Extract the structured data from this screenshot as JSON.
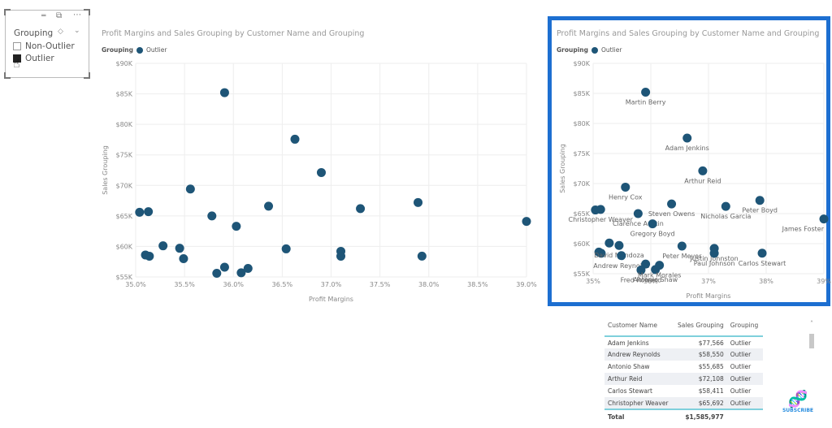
{
  "slicer": {
    "title": "Grouping",
    "items": [
      {
        "label": "Non-Outlier",
        "checked": false
      },
      {
        "label": "Outlier",
        "checked": true
      }
    ]
  },
  "chart_title": "Profit Margins and Sales Grouping by Customer Name and Grouping",
  "legend": {
    "title": "Grouping",
    "series": "Outlier"
  },
  "colors": {
    "point": "#1e5577",
    "highlight_border": "#1d6fd1"
  },
  "chart_data": [
    {
      "type": "scatter",
      "title": "Profit Margins and Sales Grouping by Customer Name and Grouping",
      "xlabel": "Profit Margins",
      "ylabel": "Sales Grouping",
      "xlim": [
        35.0,
        39.0
      ],
      "ylim": [
        55000,
        90000
      ],
      "xticks": [
        "35.0%",
        "35.5%",
        "36.0%",
        "36.5%",
        "37.0%",
        "37.5%",
        "38.0%",
        "38.5%",
        "39.0%"
      ],
      "yticks": [
        "$55K",
        "$60K",
        "$65K",
        "$70K",
        "$75K",
        "$80K",
        "$85K",
        "$90K"
      ],
      "grid": true,
      "legend_position": "top-left",
      "series": [
        {
          "name": "Outlier"
        }
      ]
    },
    {
      "type": "scatter",
      "title": "Profit Margins and Sales Grouping by Customer Name and Grouping",
      "xlabel": "Profit Margins",
      "ylabel": "Sales Grouping",
      "xlim": [
        35.0,
        39.0
      ],
      "ylim": [
        55000,
        90000
      ],
      "xticks": [
        "35%",
        "36%",
        "37%",
        "38%",
        "39%"
      ],
      "yticks": [
        "$55K",
        "$60K",
        "$65K",
        "$70K",
        "$75K",
        "$80K",
        "$85K",
        "$90K"
      ],
      "grid": true,
      "legend_position": "top-left",
      "data_labels": true,
      "series": [
        {
          "name": "Outlier"
        }
      ]
    }
  ],
  "points": [
    {
      "x": 35.04,
      "y": 65600,
      "name": ""
    },
    {
      "x": 35.13,
      "y": 65692,
      "name": "Christopher Weaver"
    },
    {
      "x": 35.1,
      "y": 58600,
      "name": ""
    },
    {
      "x": 35.14,
      "y": 58400,
      "name": ""
    },
    {
      "x": 35.28,
      "y": 60100,
      "name": ""
    },
    {
      "x": 35.45,
      "y": 59700,
      "name": "David Mendoza"
    },
    {
      "x": 35.49,
      "y": 58000,
      "name": "Andrew Reynolds"
    },
    {
      "x": 35.56,
      "y": 69400,
      "name": "Henry Cox"
    },
    {
      "x": 35.78,
      "y": 65000,
      "name": "Clarence Austin"
    },
    {
      "x": 35.91,
      "y": 85200,
      "name": "Martin Berry"
    },
    {
      "x": 35.91,
      "y": 56600,
      "name": ""
    },
    {
      "x": 35.83,
      "y": 55600,
      "name": "Fred Romero"
    },
    {
      "x": 36.03,
      "y": 63300,
      "name": "Gregory Boyd"
    },
    {
      "x": 36.08,
      "y": 55685,
      "name": "Antonio Shaw"
    },
    {
      "x": 36.15,
      "y": 56400,
      "name": "Mark Morales"
    },
    {
      "x": 36.36,
      "y": 66600,
      "name": "Steven Owens"
    },
    {
      "x": 36.54,
      "y": 59600,
      "name": "Peter Meyer"
    },
    {
      "x": 36.63,
      "y": 77566,
      "name": "Adam Jenkins"
    },
    {
      "x": 36.9,
      "y": 72108,
      "name": "Arthur Reid"
    },
    {
      "x": 37.1,
      "y": 59200,
      "name": "Justin Johnston"
    },
    {
      "x": 37.1,
      "y": 58400,
      "name": "Paul Johnson"
    },
    {
      "x": 37.3,
      "y": 66200,
      "name": "Nicholas Garcia"
    },
    {
      "x": 37.89,
      "y": 67200,
      "name": "Peter Boyd"
    },
    {
      "x": 37.93,
      "y": 58411,
      "name": "Carlos Stewart"
    },
    {
      "x": 39.0,
      "y": 64100,
      "name": "James Foster"
    }
  ],
  "table": {
    "headers": [
      "Customer Name",
      "Sales Grouping",
      "Grouping"
    ],
    "rows": [
      [
        "Adam Jenkins",
        "$77,566",
        "Outlier"
      ],
      [
        "Andrew Reynolds",
        "$58,550",
        "Outlier"
      ],
      [
        "Antonio Shaw",
        "$55,685",
        "Outlier"
      ],
      [
        "Arthur Reid",
        "$72,108",
        "Outlier"
      ],
      [
        "Carlos Stewart",
        "$58,411",
        "Outlier"
      ],
      [
        "Christopher Weaver",
        "$65,692",
        "Outlier"
      ]
    ],
    "total_label": "Total",
    "total_value": "$1,585,977"
  },
  "subscribe": "SUBSCRIBE"
}
